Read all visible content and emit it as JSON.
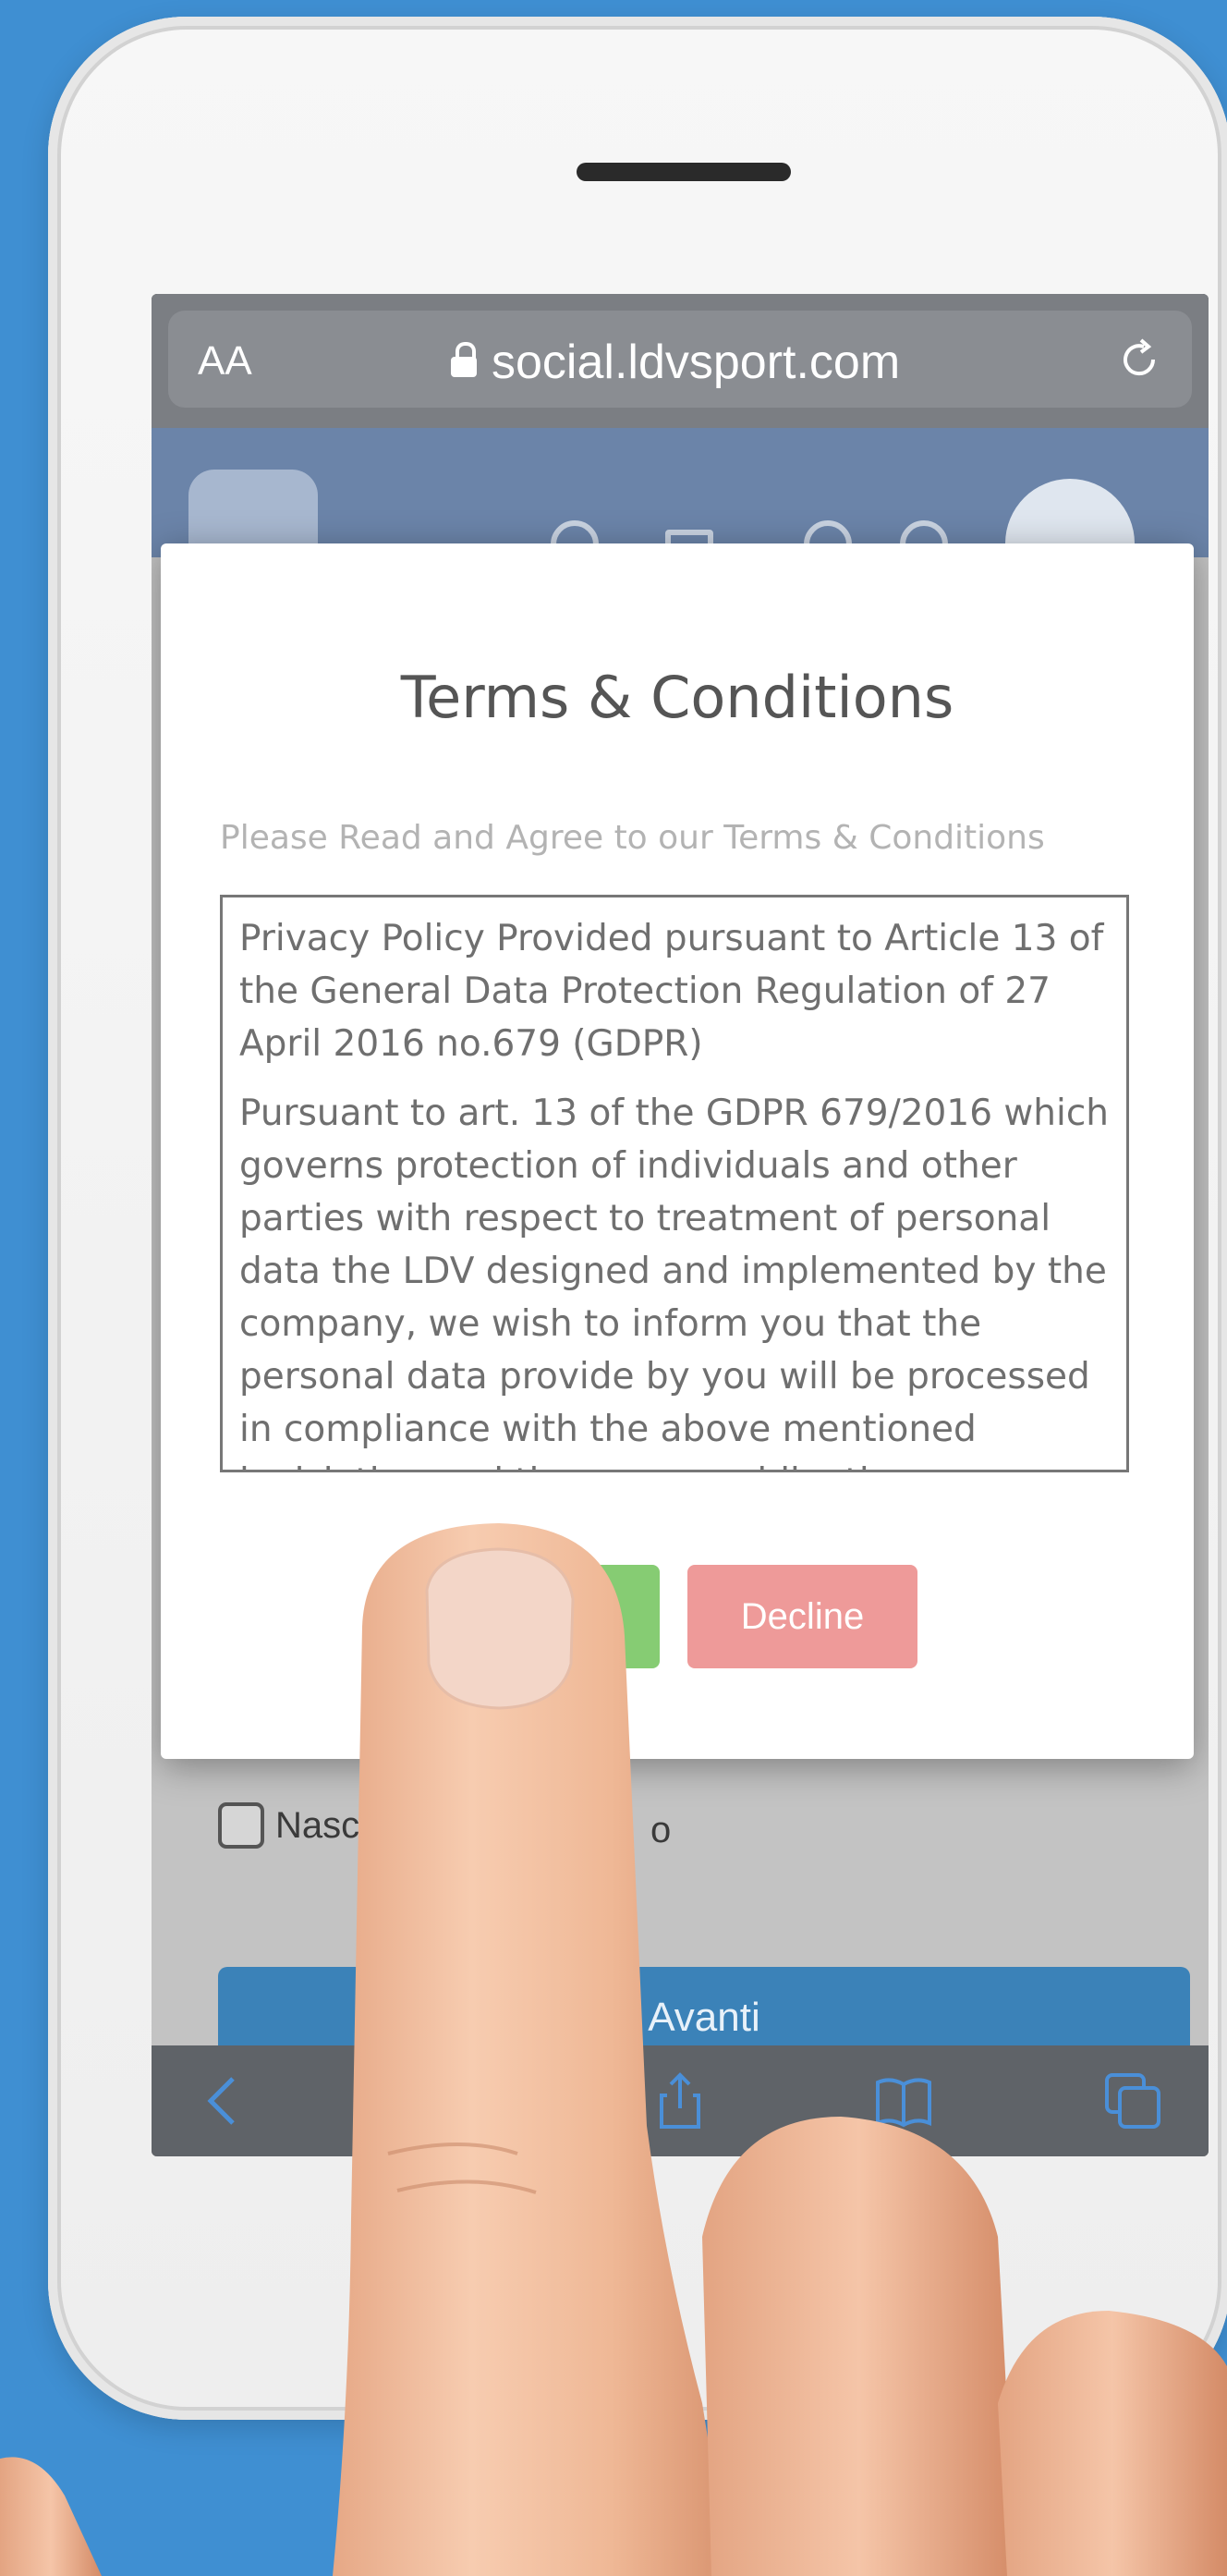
{
  "browser": {
    "text_size_label": "AA",
    "url": "social.ldvsport.com"
  },
  "modal": {
    "title": "Terms & Conditions",
    "subtitle": "Please Read and Agree to our Terms & Conditions",
    "terms_paragraphs": [
      "Privacy Policy Provided pursuant to Article 13 of the General Data Protection Regulation of 27 April 2016 no.679 (GDPR)",
      "Pursuant to art. 13 of the GDPR 679/2016 which governs protection of individuals and other parties with respect to treatment of personal data the LDV designed and implemented by the company, we wish to inform you that the personal data provide by you will be processed in compliance with the above mentioned legislation and the secrecy obligations"
    ],
    "decline_label": "Decline"
  },
  "page": {
    "checkbox_label_start": "Nascon",
    "checkbox_label_end": "o",
    "next_button_label": "Avanti"
  },
  "colors": {
    "background": "#3f8fd2",
    "accept": "#86cc73",
    "decline": "#ee9a99",
    "next": "#3b82b8"
  },
  "toolbar_icons": [
    "back-icon",
    "share-icon",
    "bookmarks-icon",
    "tabs-icon"
  ]
}
